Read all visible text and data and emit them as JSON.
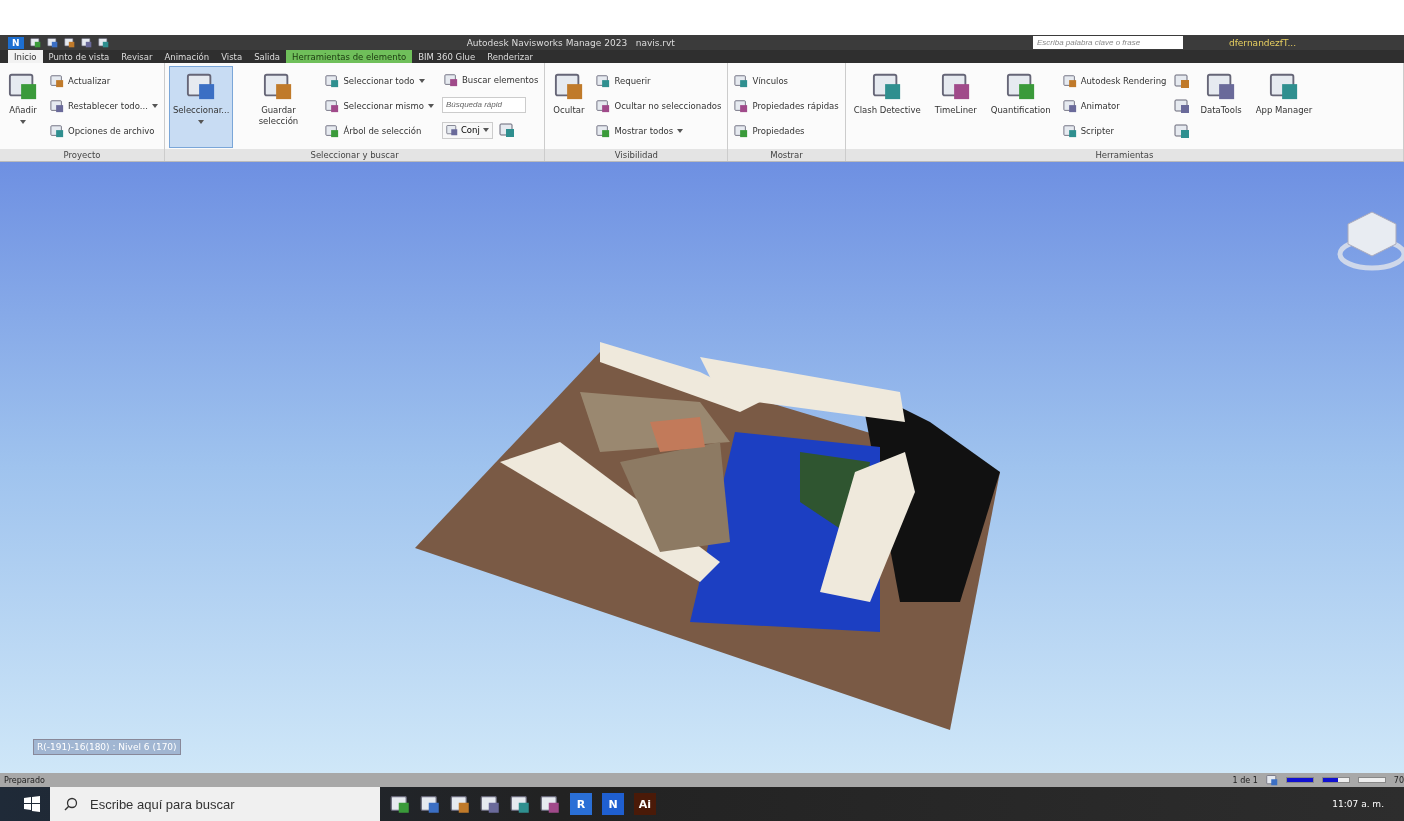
{
  "title_bar": {
    "logo": "N",
    "title": "Autodesk Navisworks Manage 2023   navis.rvt",
    "search": {
      "placeholder": "Escriba palabra clave o frase"
    },
    "user": "dfernandezfT..."
  },
  "tabs": [
    {
      "label": "Inicio",
      "selected": true,
      "kind": "normal"
    },
    {
      "label": "Punto de vista",
      "selected": false,
      "kind": "normal"
    },
    {
      "label": "Revisar",
      "selected": false,
      "kind": "normal"
    },
    {
      "label": "Animación",
      "selected": false,
      "kind": "normal"
    },
    {
      "label": "Vista",
      "selected": false,
      "kind": "normal"
    },
    {
      "label": "Salida",
      "selected": false,
      "kind": "normal"
    },
    {
      "label": "Herramientas de elemento",
      "selected": false,
      "kind": "contextual"
    },
    {
      "label": "BIM 360 Glue",
      "selected": false,
      "kind": "normal"
    },
    {
      "label": "Renderizar",
      "selected": false,
      "kind": "normal"
    }
  ],
  "ribbon": [
    {
      "label": "Proyecto",
      "items": [
        {
          "kind": "large",
          "label": "Añadir",
          "dropdown": true,
          "selected": false
        },
        {
          "kind": "column",
          "items": [
            {
              "kind": "small",
              "label": "Actualizar",
              "dropdown": false
            },
            {
              "kind": "small",
              "label": "Restablecer todo...",
              "dropdown": true
            },
            {
              "kind": "small",
              "label": "Opciones de archivo",
              "dropdown": false
            }
          ]
        }
      ]
    },
    {
      "label": "Seleccionar y buscar",
      "items": [
        {
          "kind": "large",
          "label": "Seleccionar...",
          "dropdown": true,
          "selected": true
        },
        {
          "kind": "large",
          "label": "Guardar selección",
          "dropdown": false,
          "selected": false
        },
        {
          "kind": "column",
          "items": [
            {
              "kind": "small",
              "label": "Seleccionar todo",
              "dropdown": true
            },
            {
              "kind": "small",
              "label": "Seleccionar mismo",
              "dropdown": true
            },
            {
              "kind": "small",
              "label": "Árbol de selección",
              "dropdown": false
            }
          ]
        },
        {
          "kind": "column",
          "items": [
            {
              "kind": "small",
              "label": "Buscar elementos",
              "dropdown": false
            },
            {
              "kind": "search",
              "placeholder": "Búsqueda rápid"
            },
            {
              "kind": "set",
              "label": "Conj"
            }
          ]
        }
      ]
    },
    {
      "label": "Visibilidad",
      "items": [
        {
          "kind": "large",
          "label": "Ocultar",
          "dropdown": false,
          "selected": false
        },
        {
          "kind": "column",
          "items": [
            {
              "kind": "small",
              "label": "Requerir",
              "dropdown": false
            },
            {
              "kind": "small",
              "label": "Ocultar no seleccionados",
              "dropdown": false
            },
            {
              "kind": "small",
              "label": "Mostrar todos",
              "dropdown": true
            }
          ]
        }
      ]
    },
    {
      "label": "Mostrar",
      "items": [
        {
          "kind": "column",
          "items": [
            {
              "kind": "small",
              "label": "Vínculos",
              "dropdown": false
            },
            {
              "kind": "small",
              "label": "Propiedades rápidas",
              "dropdown": false
            },
            {
              "kind": "small",
              "label": "Propiedades",
              "dropdown": false
            }
          ]
        }
      ]
    },
    {
      "label": "Herramientas",
      "items": [
        {
          "kind": "large",
          "label": "Clash Detective",
          "dropdown": false,
          "selected": false
        },
        {
          "kind": "large",
          "label": "TimeLiner",
          "dropdown": false,
          "selected": false
        },
        {
          "kind": "large",
          "label": "Quantification",
          "dropdown": false,
          "selected": false
        },
        {
          "kind": "column",
          "items": [
            {
              "kind": "small",
              "label": "Autodesk Rendering",
              "dropdown": false
            },
            {
              "kind": "small",
              "label": "Animator",
              "dropdown": false
            },
            {
              "kind": "small",
              "label": "Scripter",
              "dropdown": false
            }
          ]
        },
        {
          "kind": "icons"
        },
        {
          "kind": "large",
          "label": "DataTools",
          "dropdown": false,
          "selected": false
        },
        {
          "kind": "large",
          "label": "App Manager",
          "dropdown": false,
          "selected": false
        }
      ]
    }
  ],
  "viewport": {
    "kind": "picture",
    "hud": "R(-191)-16(180) : Nivel 6 (170)"
  },
  "status_bar": {
    "text": "Preparado",
    "pager": "1 de 1",
    "meters": [
      {
        "level": 1
      },
      {
        "level": 0.6
      },
      {
        "level": 0
      }
    ],
    "cut_text": "70"
  },
  "taskbar": {
    "search": {
      "placeholder": "Escribe aquí para buscar"
    },
    "apps": [
      {
        "label": "R",
        "color": "#2a6fd6"
      },
      {
        "label": "N",
        "color": "#1f5fd0"
      },
      {
        "label": "Ai",
        "color": "#4a1a08"
      }
    ],
    "time": "11:07 a. m."
  }
}
